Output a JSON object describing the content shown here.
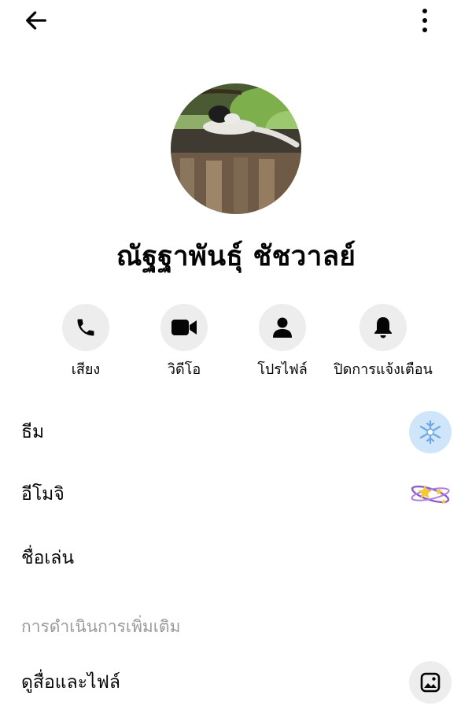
{
  "header": {
    "back_icon": "arrow-left-icon",
    "more_icon": "more-vertical-icon"
  },
  "profile": {
    "name": "ณัฐฐาพันธุ์ ชัชวาลย์",
    "avatar": "cat-on-wall-photo"
  },
  "actions": [
    {
      "label": "เสียง",
      "icon": "phone-icon"
    },
    {
      "label": "วิดีโอ",
      "icon": "video-camera-icon"
    },
    {
      "label": "โปรไฟล์",
      "icon": "person-icon"
    },
    {
      "label": "ปิดการแจ้งเตือน",
      "icon": "bell-icon"
    }
  ],
  "settings": [
    {
      "label": "ธีม",
      "icon": "snowflake-theme-icon"
    },
    {
      "label": "อีโมจิ",
      "icon": "sparkle-stars-emoji-icon"
    },
    {
      "label": "ชื่อเล่น"
    }
  ],
  "more_actions": {
    "heading": "การดำเนินการเพิ่มเติม",
    "items": [
      {
        "label": "ดูสื่อและไฟล์",
        "icon": "photo-media-icon"
      }
    ]
  },
  "colors": {
    "text": "#050505",
    "muted": "#9a9a9a",
    "button_bg": "#ededed",
    "theme_blue": "#cfe6fa"
  }
}
